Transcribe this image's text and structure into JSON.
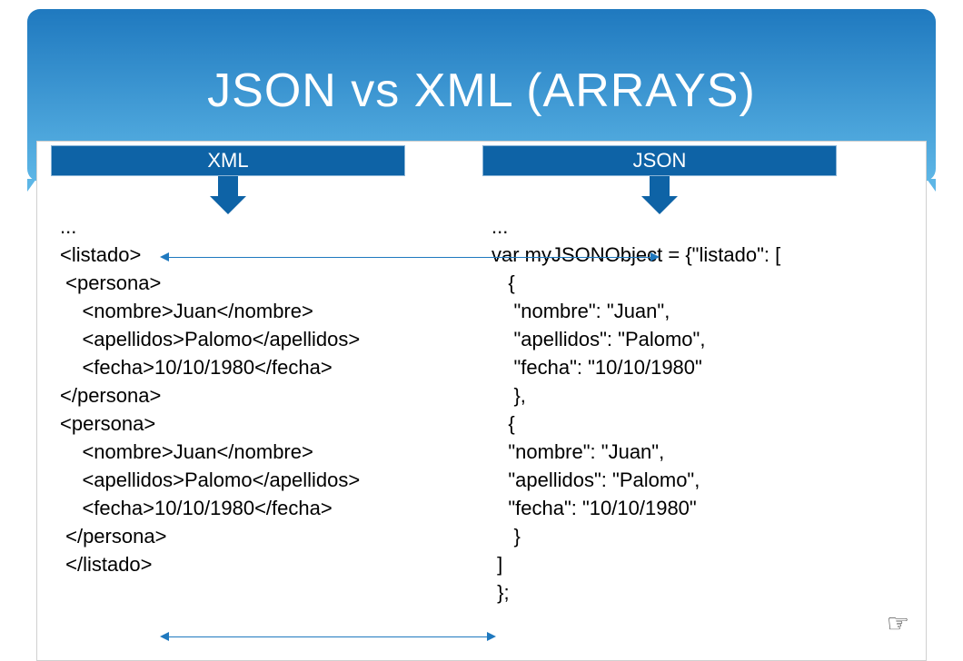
{
  "title": "JSON vs XML (ARRAYS)",
  "columns": {
    "xml_label": "XML",
    "json_label": "JSON"
  },
  "code": {
    "xml": "...\n<listado>\n <persona>\n    <nombre>Juan</nombre>\n    <apellidos>Palomo</apellidos>\n    <fecha>10/10/1980</fecha>\n</persona>\n<persona>\n    <nombre>Juan</nombre>\n    <apellidos>Palomo</apellidos>\n    <fecha>10/10/1980</fecha>\n </persona>\n </listado>",
    "json": "...\nvar myJSONObject = {\"listado\": [\n   {\n    \"nombre\": \"Juan\",\n    \"apellidos\": \"Palomo\",\n    \"fecha\": \"10/10/1980\"\n    },\n   {\n   \"nombre\": \"Juan\",\n   \"apellidos\": \"Palomo\",\n   \"fecha\": \"10/10/1980\"\n    }\n ]\n };"
  },
  "hand_icon": "☞"
}
